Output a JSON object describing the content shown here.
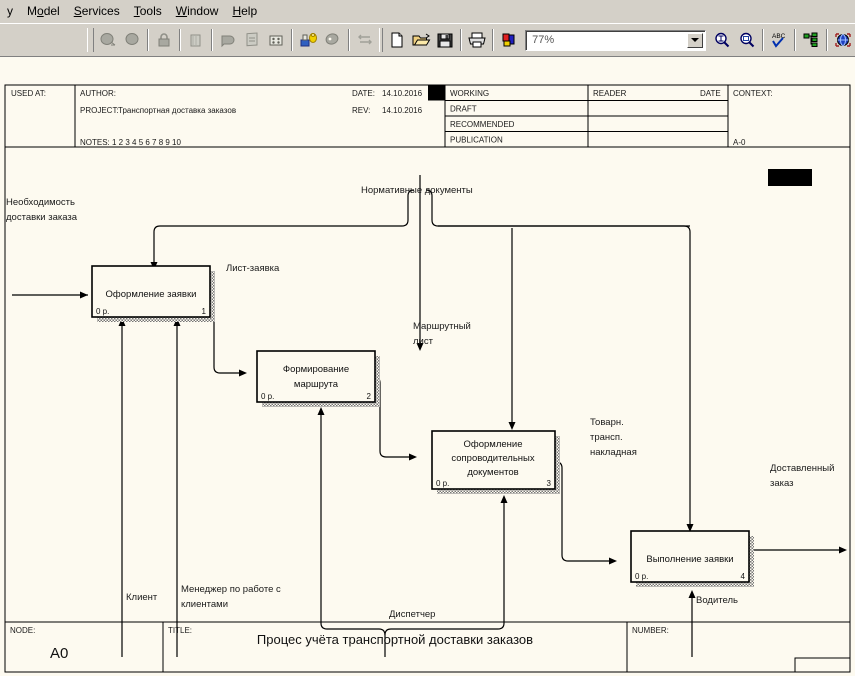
{
  "menu": {
    "items": [
      {
        "label": "y",
        "accel": ""
      },
      {
        "label": "Model",
        "accel": "o"
      },
      {
        "label": "Services",
        "accel": "S"
      },
      {
        "label": "Tools",
        "accel": "T"
      },
      {
        "label": "Window",
        "accel": "W"
      },
      {
        "label": "Help",
        "accel": "H"
      }
    ]
  },
  "toolbar": {
    "zoom_value": "77%",
    "icons": [
      "decompose-icon",
      "compose-icon",
      "lock-icon",
      "book-icon",
      "arrow-shape-icon",
      "report-icon",
      "grid-icon",
      "activity-cost-icon",
      "paint-icon",
      "swap-icon",
      "new-document-icon",
      "open-folder-icon",
      "save-disk-icon",
      "print-icon",
      "color-palette-icon",
      "zoom-in-icon",
      "zoom-fit-icon",
      "spell-check-icon",
      "model-tree-icon",
      "publish-web-icon"
    ]
  },
  "title_block": {
    "used_at_label": "USED AT:",
    "author_label": "AUTHOR:",
    "author_value": "",
    "project_label": "PROJECT:",
    "project_value": "Транспортная доставка заказов",
    "notes_label": "NOTES:",
    "notes_numbers": "1 2 3 4 5 6 7 8 9 10",
    "date_label": "DATE:",
    "date_value": "14.10.2016",
    "rev_label": "REV:",
    "rev_value": "14.10.2016",
    "status_rows": [
      "WORKING",
      "DRAFT",
      "RECOMMENDED",
      "PUBLICATION"
    ],
    "reader_label": "READER",
    "date_col_label": "DATE",
    "context_label": "CONTEXT:",
    "context_node": "A-0"
  },
  "footer": {
    "node_label": "NODE:",
    "node_value": "A0",
    "title_label": "TITLE:",
    "title_value": "Процес учёта транспортной  доставки заказов",
    "number_label": "NUMBER:",
    "number_value": ""
  },
  "diagram": {
    "boxes": [
      {
        "id": "box1",
        "name": "Оформление заявки",
        "name_line2": "",
        "cost": "0 р.",
        "number": "1"
      },
      {
        "id": "box2",
        "name": "Формирование",
        "name_line2": "маршрута",
        "cost": "0 р.",
        "number": "2"
      },
      {
        "id": "box3",
        "name": "Оформление",
        "name_line2": "сопроводительных",
        "name_line3": "документов",
        "cost": "0 р.",
        "number": "3"
      },
      {
        "id": "box4",
        "name": "Выполнение заявки",
        "name_line2": "",
        "cost": "0 р.",
        "number": "4"
      }
    ],
    "arrows": {
      "input": {
        "line1": "Необходимость",
        "line2": "доставки заказа"
      },
      "control": "Нормативные документы",
      "flow1": "Лист-заявка",
      "flow2": {
        "line1": "Маршрутный",
        "line2": "лист"
      },
      "flow3": {
        "line1": "Товарн.",
        "line2": "трансп.",
        "line3": "накладная"
      },
      "output": {
        "line1": "Доставленный",
        "line2": "заказ"
      },
      "mech1": "Клиент",
      "mech2": {
        "line1": "Менеджер по работе с",
        "line2": "клиентами"
      },
      "mech3": "Диспетчер",
      "mech4": "Водитель"
    }
  },
  "colors": {
    "canvas_bg": "#fdfaf0",
    "chrome_bg": "#d4d0c8",
    "line": "#000000"
  }
}
